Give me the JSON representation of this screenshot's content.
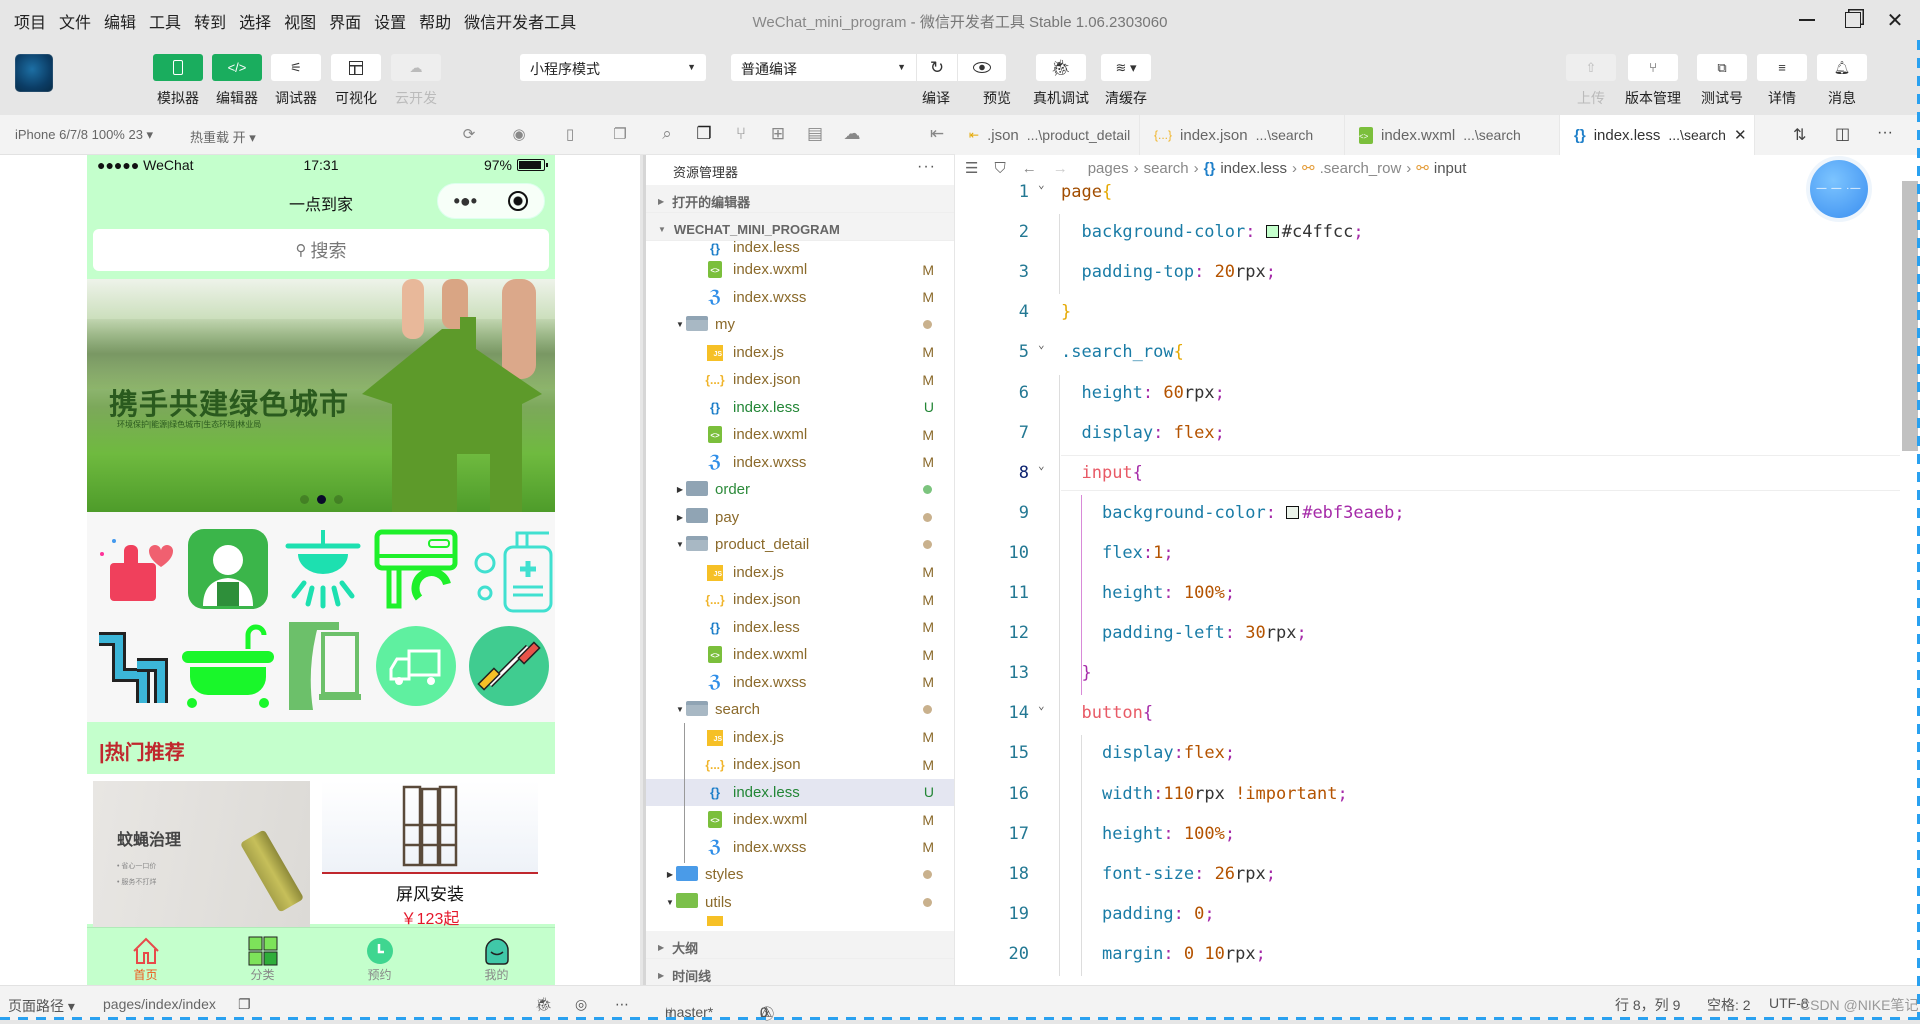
{
  "menubar": {
    "items": [
      "项目",
      "文件",
      "编辑",
      "工具",
      "转到",
      "选择",
      "视图",
      "界面",
      "设置",
      "帮助",
      "微信开发者工具"
    ],
    "title": "WeChat_mini_program",
    "subtitle": " - 微信开发者工具 Stable 1.06.2303060",
    "window_controls": [
      "minimize",
      "restore",
      "close"
    ]
  },
  "toolbar": {
    "left_buttons": [
      {
        "label": "模拟器",
        "icon": "phone-icon",
        "state": "active"
      },
      {
        "label": "编辑器",
        "icon": "code-icon",
        "state": "active"
      },
      {
        "label": "调试器",
        "icon": "sliders-icon",
        "state": "normal"
      },
      {
        "label": "可视化",
        "icon": "layout-icon",
        "state": "normal"
      },
      {
        "label": "云开发",
        "icon": "cloud-icon",
        "state": "disabled"
      }
    ],
    "mode_select": "小程序模式",
    "compile_select": "普通编译",
    "mid_buttons": [
      {
        "label": "编译",
        "icon": "refresh-icon"
      },
      {
        "label": "预览",
        "icon": "eye-icon"
      },
      {
        "label": "真机调试",
        "icon": "bug-icon"
      },
      {
        "label": "清缓存",
        "icon": "layers-icon"
      }
    ],
    "right_buttons": [
      {
        "label": "上传",
        "icon": "upload-icon",
        "state": "disabled"
      },
      {
        "label": "版本管理",
        "icon": "branch-icon",
        "state": "normal"
      },
      {
        "label": "测试号",
        "icon": "external-icon",
        "state": "normal"
      },
      {
        "label": "详情",
        "icon": "menu-icon",
        "state": "normal"
      },
      {
        "label": "消息",
        "icon": "bell-icon",
        "state": "normal"
      }
    ]
  },
  "simulator": {
    "device": "iPhone 6/7/8 100% 23",
    "hot_reload": "热重载 开",
    "status": {
      "carrier": "●●●●● WeChat",
      "time": "17:31",
      "battery": "97%",
      "battery_level": 0.97
    },
    "nav_title": "一点到家",
    "capsule_more": "•●•",
    "search_placeholder": "搜索",
    "banner": {
      "title": "携手共建绿色城市",
      "subtitle": "环境保护|能源|绿色城市|生态环境|林业局",
      "slides": 3,
      "active_slide": 1
    },
    "categories": [
      {
        "name": "thumbs-up",
        "color": "#f0405c"
      },
      {
        "name": "worker",
        "color": "#3bb54a"
      },
      {
        "name": "lamp",
        "color": "#1de0b0"
      },
      {
        "name": "air-conditioner",
        "color": "#1ef02a"
      },
      {
        "name": "sanitizer",
        "color": "#40e0d0"
      },
      {
        "name": "pipe",
        "color": "#3cb6d8"
      },
      {
        "name": "bathtub",
        "color": "#19f72a"
      },
      {
        "name": "curtain",
        "color": "#6cc06a"
      },
      {
        "name": "truck",
        "color": "#5ff0a0"
      },
      {
        "name": "dumbbell",
        "color": "#40cc90"
      }
    ],
    "hot_title": "|热门推荐",
    "products": [
      {
        "title": "蚊蝇治理",
        "bullets": [
          "• 省心一口价",
          "• 服务不打烊"
        ]
      },
      {
        "title": "屏风安装",
        "price": "￥123起"
      }
    ],
    "tabbar": [
      {
        "label": "首页",
        "icon": "home-icon",
        "active": true
      },
      {
        "label": "分类",
        "icon": "grid-icon",
        "active": false
      },
      {
        "label": "预约",
        "icon": "clock-icon",
        "active": false
      },
      {
        "label": "我的",
        "icon": "user-icon",
        "active": false
      }
    ],
    "footer": {
      "path_label": "页面路径",
      "path": "pages/index/index"
    }
  },
  "explorer": {
    "title": "资源管理器",
    "open_editors": "打开的编辑器",
    "project": "WECHAT_MINI_PROGRAM",
    "tree": [
      {
        "type": "less",
        "name": "index.less",
        "depth": 2,
        "status": ""
      },
      {
        "type": "wxml",
        "name": "index.wxml",
        "depth": 2,
        "status": "M"
      },
      {
        "type": "wxss",
        "name": "index.wxss",
        "depth": 2,
        "status": "M"
      },
      {
        "type": "folder-open",
        "name": "my",
        "depth": 1,
        "status": "dot"
      },
      {
        "type": "js",
        "name": "index.js",
        "depth": 2,
        "status": "M"
      },
      {
        "type": "json",
        "name": "index.json",
        "depth": 2,
        "status": "M"
      },
      {
        "type": "less",
        "name": "index.less",
        "depth": 2,
        "status": "U"
      },
      {
        "type": "wxml",
        "name": "index.wxml",
        "depth": 2,
        "status": "M"
      },
      {
        "type": "wxss",
        "name": "index.wxss",
        "depth": 2,
        "status": "M"
      },
      {
        "type": "folder",
        "name": "order",
        "depth": 1,
        "status": "dot-green"
      },
      {
        "type": "folder",
        "name": "pay",
        "depth": 1,
        "status": "dot"
      },
      {
        "type": "folder-open",
        "name": "product_detail",
        "depth": 1,
        "status": "dot"
      },
      {
        "type": "js",
        "name": "index.js",
        "depth": 2,
        "status": "M"
      },
      {
        "type": "json",
        "name": "index.json",
        "depth": 2,
        "status": "M"
      },
      {
        "type": "less",
        "name": "index.less",
        "depth": 2,
        "status": "M"
      },
      {
        "type": "wxml",
        "name": "index.wxml",
        "depth": 2,
        "status": "M"
      },
      {
        "type": "wxss",
        "name": "index.wxss",
        "depth": 2,
        "status": "M"
      },
      {
        "type": "folder-open",
        "name": "search",
        "depth": 1,
        "status": "dot"
      },
      {
        "type": "js",
        "name": "index.js",
        "depth": 2,
        "status": "M"
      },
      {
        "type": "json",
        "name": "index.json",
        "depth": 2,
        "status": "M"
      },
      {
        "type": "less",
        "name": "index.less",
        "depth": 2,
        "status": "U",
        "selected": true
      },
      {
        "type": "wxml",
        "name": "index.wxml",
        "depth": 2,
        "status": "M"
      },
      {
        "type": "wxss",
        "name": "index.wxss",
        "depth": 2,
        "status": "M"
      },
      {
        "type": "folder-blue",
        "name": "styles",
        "depth": 0,
        "status": "dot"
      },
      {
        "type": "folder-green",
        "name": "utils",
        "depth": 0,
        "status": "dot",
        "open": true
      }
    ],
    "outline": "大纲",
    "timeline": "时间线"
  },
  "editor": {
    "tabs": [
      {
        "name": ".json",
        "path": "...\\product_detail",
        "icon": "json"
      },
      {
        "name": "index.json",
        "path": "...\\search",
        "icon": "json"
      },
      {
        "name": "index.wxml",
        "path": "...\\search",
        "icon": "wxml"
      },
      {
        "name": "index.less",
        "path": "...\\search",
        "icon": "less",
        "active": true
      }
    ],
    "breadcrumb": [
      "pages",
      "search",
      "index.less",
      ".search_row",
      "input"
    ],
    "cursor_line": 8,
    "lines": [
      "page{",
      "  background-color: #c4ffcc;",
      "  padding-top: 20rpx;",
      "}",
      ".search_row{",
      "  height: 60rpx;",
      "  display: flex;",
      "  input{",
      "    background-color: #ebf3eaeb;",
      "    flex:1;",
      "    height: 100%;",
      "    padding-left: 30rpx;",
      "  }",
      "  button{",
      "    display:flex;",
      "    width:110rpx !important;",
      "    height: 100%;",
      "    font-size: 26rpx;",
      "    padding: 0;",
      "    margin: 0 10rpx;"
    ],
    "swatches": {
      "line2": "#c4ffcc",
      "line9": "#ebf3ea"
    }
  },
  "statusbar": {
    "branch": "master*",
    "errors": "0",
    "warnings": "0",
    "position": "行 8，列 9",
    "spaces": "空格: 2",
    "encoding": "UTF-8",
    "watermark": "CSDN @NIKE笔记"
  }
}
